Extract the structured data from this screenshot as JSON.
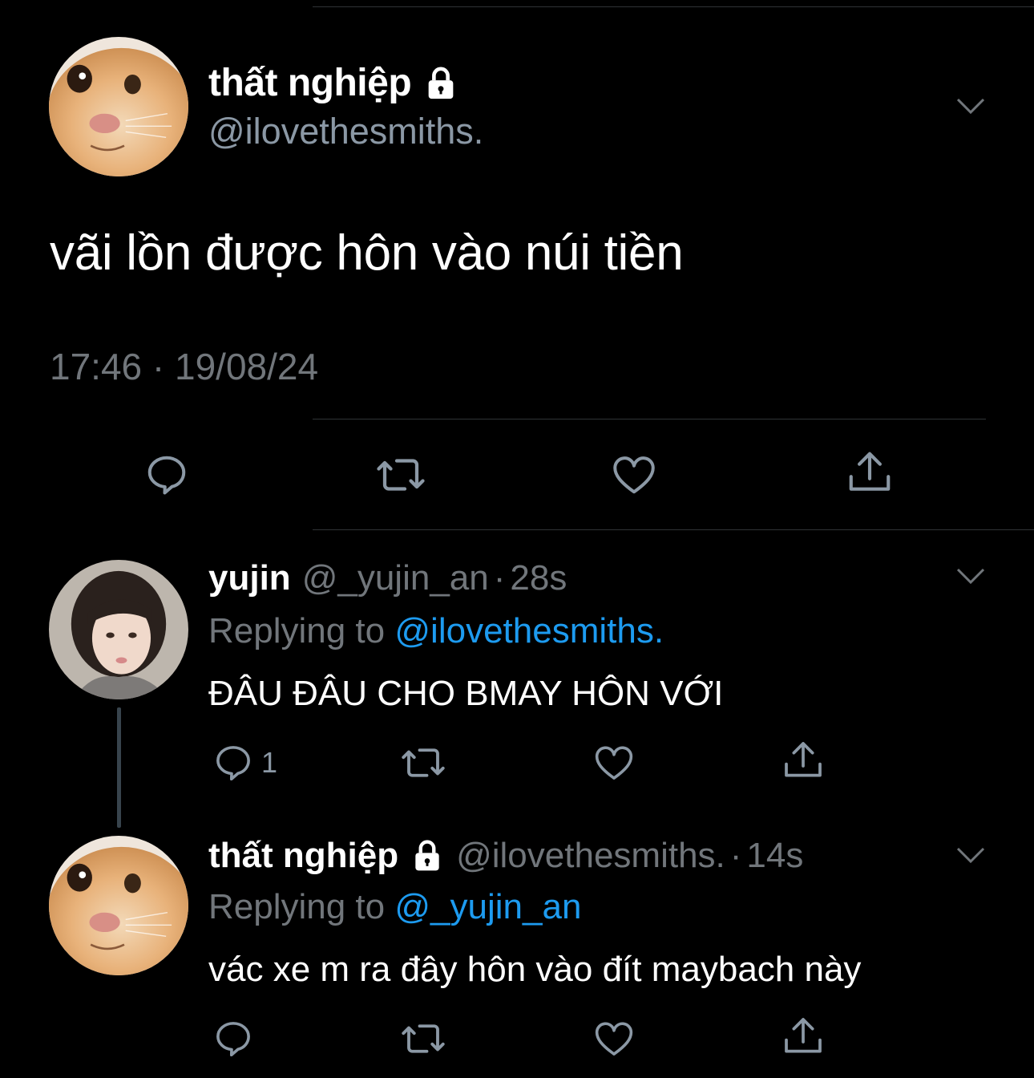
{
  "main_tweet": {
    "name": "thất nghiệp",
    "handle": "@ilovethesmiths.",
    "text": "vãi lồn được hôn vào núi tiền",
    "timestamp": "17:46 · 19/08/24",
    "avatar": "cat-avatar",
    "protected_icon": "lock-icon"
  },
  "replies": [
    {
      "name": "yujin",
      "handle": "@_yujin_an",
      "separator": "·",
      "age": "28s",
      "replying_prefix": "Replying to",
      "replying_to": "@ilovethesmiths.",
      "text": "ĐÂU ĐÂU CHO BMAY HÔN VỚI",
      "reply_count": "1",
      "avatar": "girl-avatar"
    },
    {
      "name": "thất nghiệp",
      "handle": "@ilovethesmiths.",
      "separator": "·",
      "age": "14s",
      "replying_prefix": "Replying to",
      "replying_to": "@_yujin_an",
      "text": "vác xe m ra đây hôn vào đít maybach này",
      "reply_count": "",
      "avatar": "cat-avatar"
    }
  ],
  "colors": {
    "background": "#000000",
    "secondary_text": "#71767b",
    "link": "#1d9bf0",
    "divider": "#2f3336"
  }
}
